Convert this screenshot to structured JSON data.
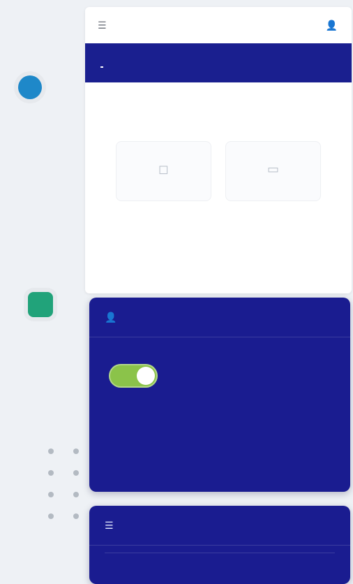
{
  "phone": {
    "menu_icon": "menu-icon",
    "title": "",
    "profile_icon": "profile-icon",
    "tabs": [
      {
        "label": "",
        "active": true
      },
      {
        "label": "",
        "active": false
      }
    ],
    "text_line1": "",
    "text_line2": "",
    "stats": [
      {
        "icon": "placeholder-icon",
        "label": ""
      },
      {
        "icon": "placeholder-icon",
        "label": ""
      }
    ]
  },
  "card1": {
    "icon": "user-icon",
    "title": "",
    "lines": [
      "",
      "",
      "",
      ""
    ],
    "bold_line": "",
    "toggle_label": "",
    "toggle_on": true,
    "accent": "#8bc34a"
  },
  "card2": {
    "icon": "list-icon",
    "title": "",
    "subtitle": ""
  },
  "colors": {
    "tabs_bg": "#1a1f8f",
    "card_bg": "#1a1c90",
    "page_bg": "#eef1f5",
    "left_dot_1": "#1e88c9",
    "left_square_2": "#21a37a"
  }
}
